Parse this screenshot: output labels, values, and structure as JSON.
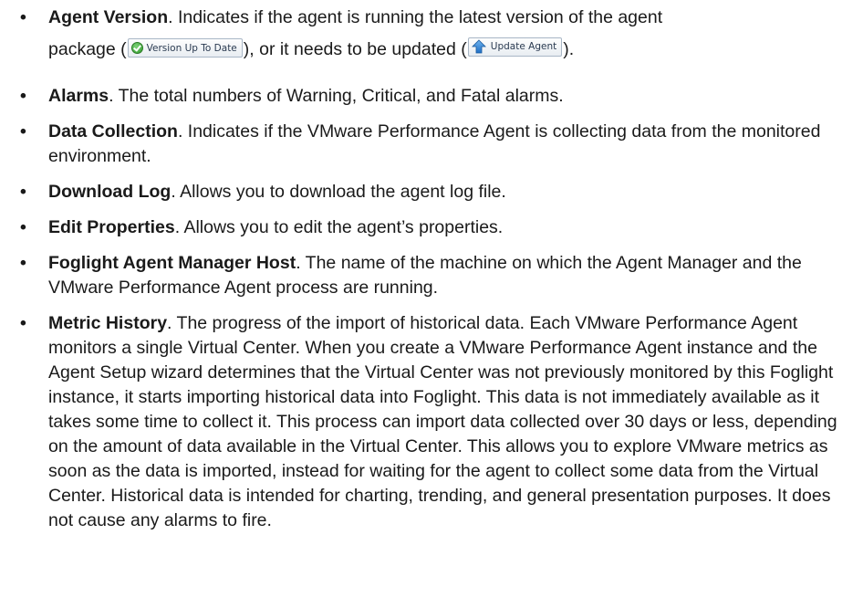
{
  "bullet_char": "•",
  "items": [
    {
      "term": "Agent Version",
      "text_before_buttons": ". Indicates if the agent is running the latest version of the agent",
      "line2_start": "package (",
      "line2_middle": "), or it needs to be updated (",
      "line2_end": ").",
      "buttons": {
        "version_up_to_date": {
          "label": "Version Up To Date",
          "icon": "green-check-icon"
        },
        "update_agent": {
          "label": "Update Agent",
          "icon": "blue-up-arrow-icon"
        }
      }
    },
    {
      "term": "Alarms",
      "text": ". The total numbers of Warning, Critical, and Fatal alarms."
    },
    {
      "term": "Data Collection",
      "text": ". Indicates if the VMware Performance Agent is collecting data from the monitored environment."
    },
    {
      "term": "Download Log",
      "text": ". Allows you to download the agent log file."
    },
    {
      "term": "Edit Properties",
      "text": ". Allows you to edit the agent’s properties."
    },
    {
      "term": "Foglight Agent Manager Host",
      "text": ". The name of the machine on which the Agent Manager and the VMware Performance Agent process are running."
    },
    {
      "term": "Metric History",
      "text": ". The progress of the import of historical data. Each VMware Performance Agent monitors a single Virtual Center. When you create a VMware Performance Agent instance and the Agent Setup wizard determines that the Virtual Center was not previously monitored by this Foglight instance, it starts importing historical data into Foglight. This data is not immediately available as it takes some time to collect it. This process can import data collected over 30 days or less, depending on the amount of data available in the Virtual Center. This allows you to explore VMware metrics as soon as the data is imported, instead for waiting for the agent to collect some data from the Virtual Center. Historical data is intended for charting, trending, and general presentation purposes. It does not cause any alarms to fire."
    }
  ]
}
